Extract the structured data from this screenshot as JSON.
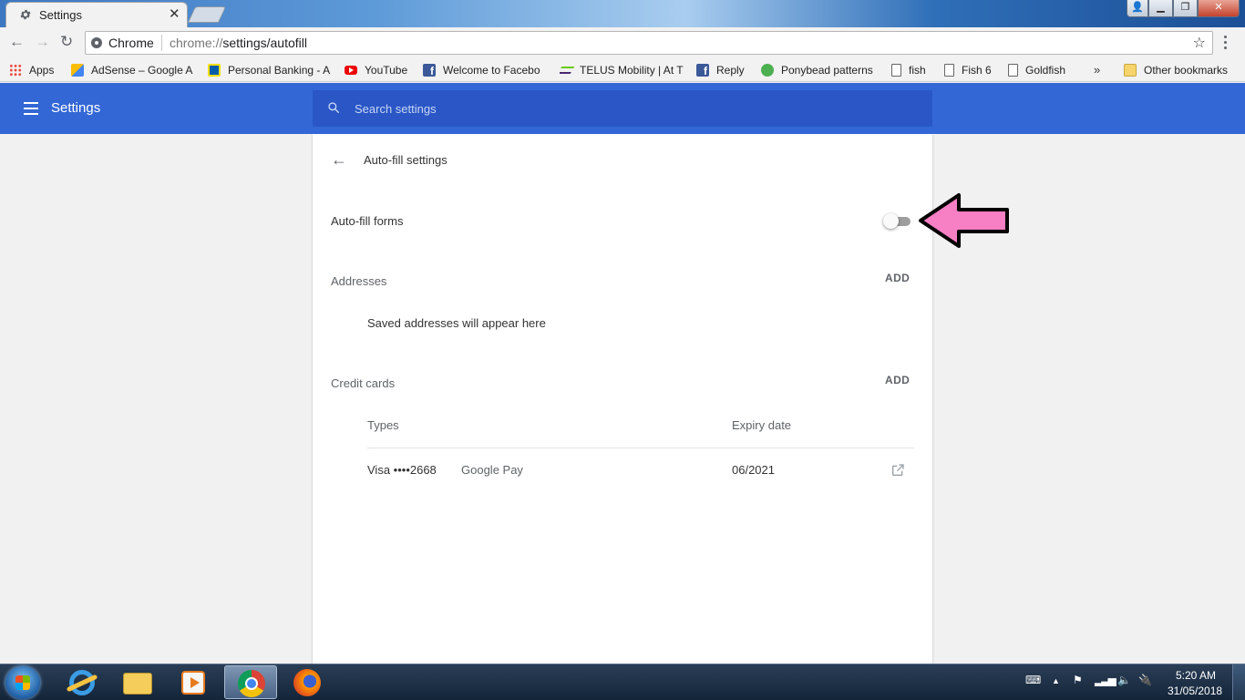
{
  "browser": {
    "tab_title": "Settings",
    "tab_close": "✕",
    "window_controls": {
      "user": "👤",
      "minimize": "▁",
      "maximize": "❐",
      "close": "✕"
    },
    "nav": {
      "back": "←",
      "forward": "→",
      "reload": "↻"
    },
    "omnibox": {
      "chip": "Chrome",
      "url_prefix": "chrome://",
      "url_path": "settings/autofill",
      "star": "☆"
    },
    "bookmarks": [
      {
        "label": "Apps",
        "icon": "apps-icon"
      },
      {
        "label": "AdSense – Google A",
        "icon": "adsense-icon"
      },
      {
        "label": "Personal Banking - A",
        "icon": "rbc-icon"
      },
      {
        "label": "YouTube",
        "icon": "youtube-icon"
      },
      {
        "label": "Welcome to Facebo",
        "icon": "facebook-icon"
      },
      {
        "label": "TELUS Mobility | At T",
        "icon": "telus-icon"
      },
      {
        "label": "Reply",
        "icon": "facebook-icon"
      },
      {
        "label": "Ponybead patterns",
        "icon": "ponybead-icon"
      },
      {
        "label": "fish",
        "icon": "page-icon"
      },
      {
        "label": "Fish 6",
        "icon": "page-icon"
      },
      {
        "label": "Goldfish",
        "icon": "page-icon"
      }
    ],
    "bookmarks_more": "»",
    "other_bookmarks": "Other bookmarks"
  },
  "settings": {
    "header_title": "Settings",
    "search_placeholder": "Search settings",
    "page_title": "Auto-fill settings",
    "autofill_forms_label": "Auto-fill forms",
    "autofill_enabled": false,
    "addresses": {
      "label": "Addresses",
      "add_label": "ADD",
      "empty_text": "Saved addresses will appear here"
    },
    "credit_cards": {
      "label": "Credit cards",
      "add_label": "ADD",
      "columns": [
        "Types",
        "Expiry date"
      ],
      "rows": [
        {
          "type": "Visa ••••2668",
          "source": "Google Pay",
          "expiry": "06/2021"
        }
      ]
    }
  },
  "annotation": {
    "arrow_color": "#f77fc4",
    "points_to": "auto-fill-toggle"
  },
  "colors": {
    "header_blue": "#3367d6",
    "search_blue": "#2a56c6"
  },
  "taskbar": {
    "apps": [
      "internet-explorer-icon",
      "file-explorer-icon",
      "media-player-icon",
      "chrome-icon",
      "firefox-icon"
    ],
    "active_app": "chrome-icon",
    "time": "5:20 AM",
    "date": "31/05/2018"
  }
}
